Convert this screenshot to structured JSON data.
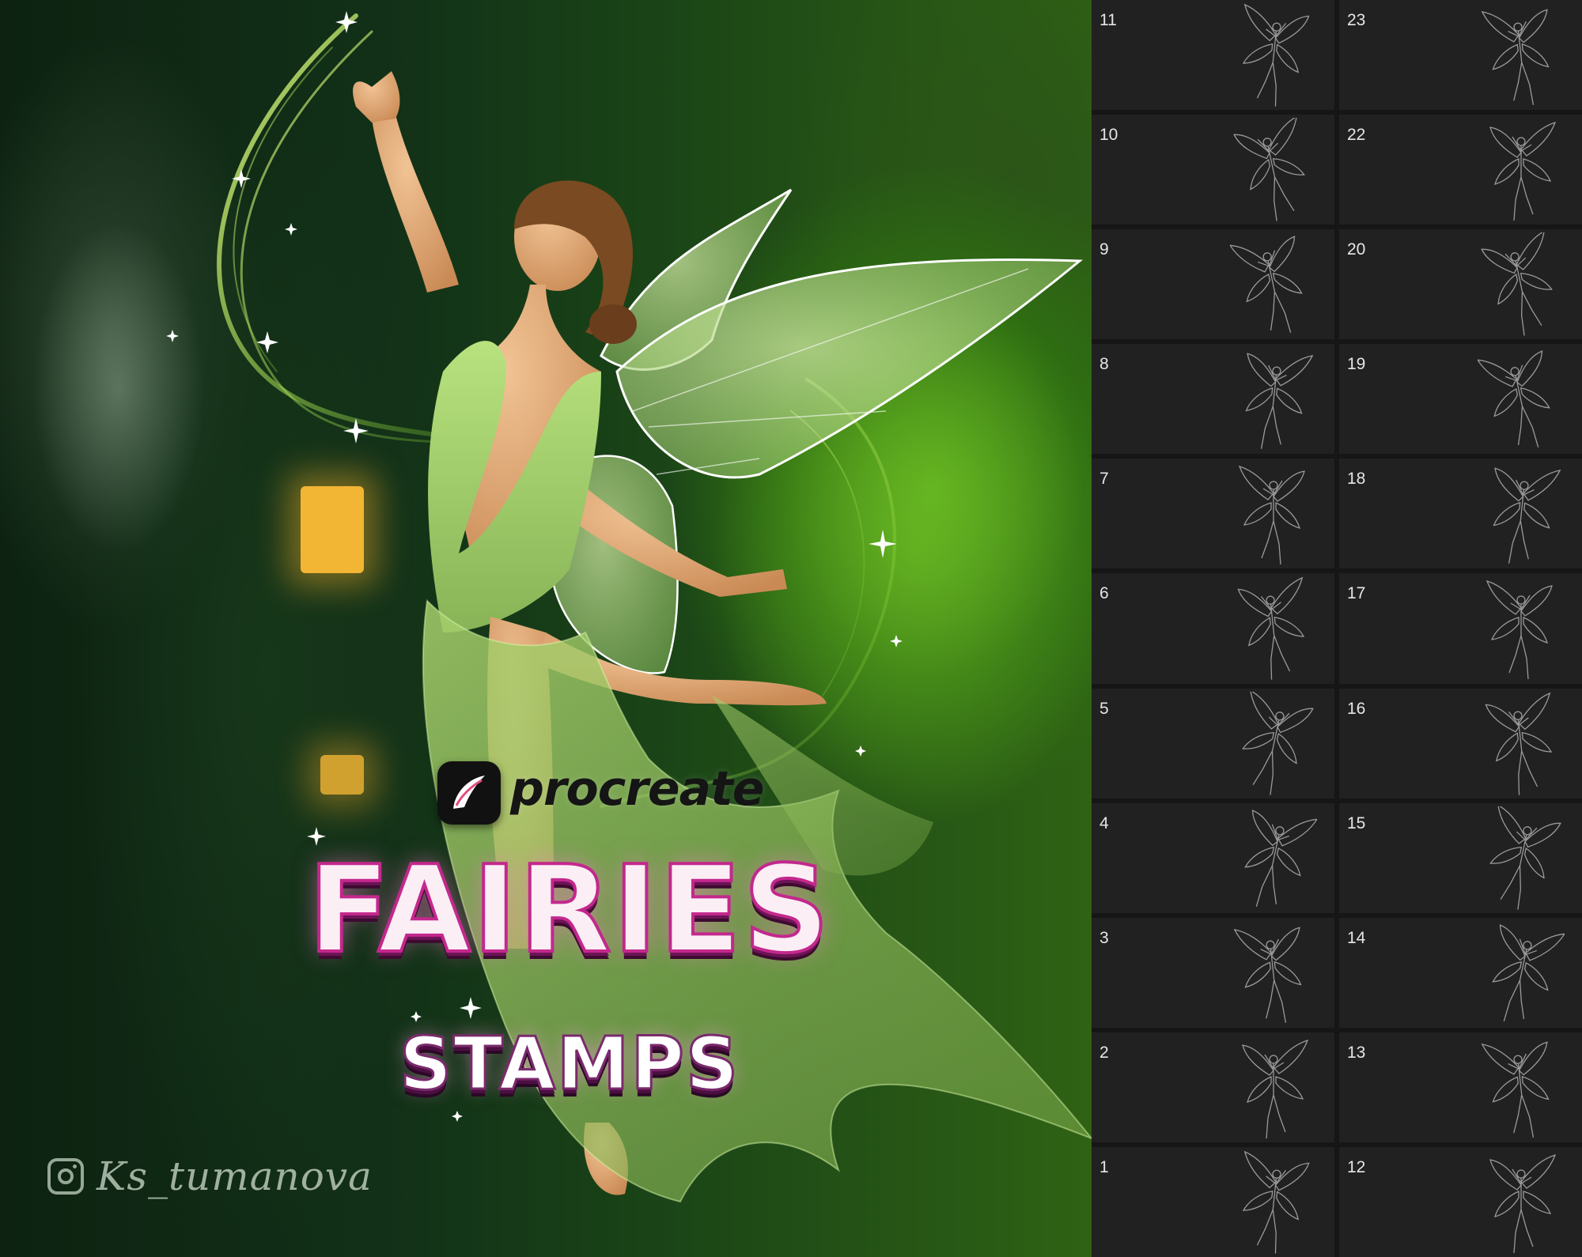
{
  "branding": {
    "app_name": "procreate",
    "title_main": "FAIRIES",
    "title_sub": "STAMPS",
    "instagram_handle": "Ks_tumanova"
  },
  "colors": {
    "title_pink": "#c3288d",
    "forest_green": "#2f6f12",
    "panel_bg": "#161616",
    "cell_bg": "#212121",
    "dress_green": "#a7d76a"
  },
  "icons": {
    "instagram": "instagram-icon",
    "procreate": "procreate-app-icon"
  },
  "brush_library": {
    "left_column": [
      "11",
      "10",
      "9",
      "8",
      "7",
      "6",
      "5",
      "4",
      "3",
      "2",
      "1"
    ],
    "right_column": [
      "23",
      "22",
      "20",
      "19",
      "18",
      "17",
      "16",
      "15",
      "14",
      "13",
      "12"
    ]
  }
}
